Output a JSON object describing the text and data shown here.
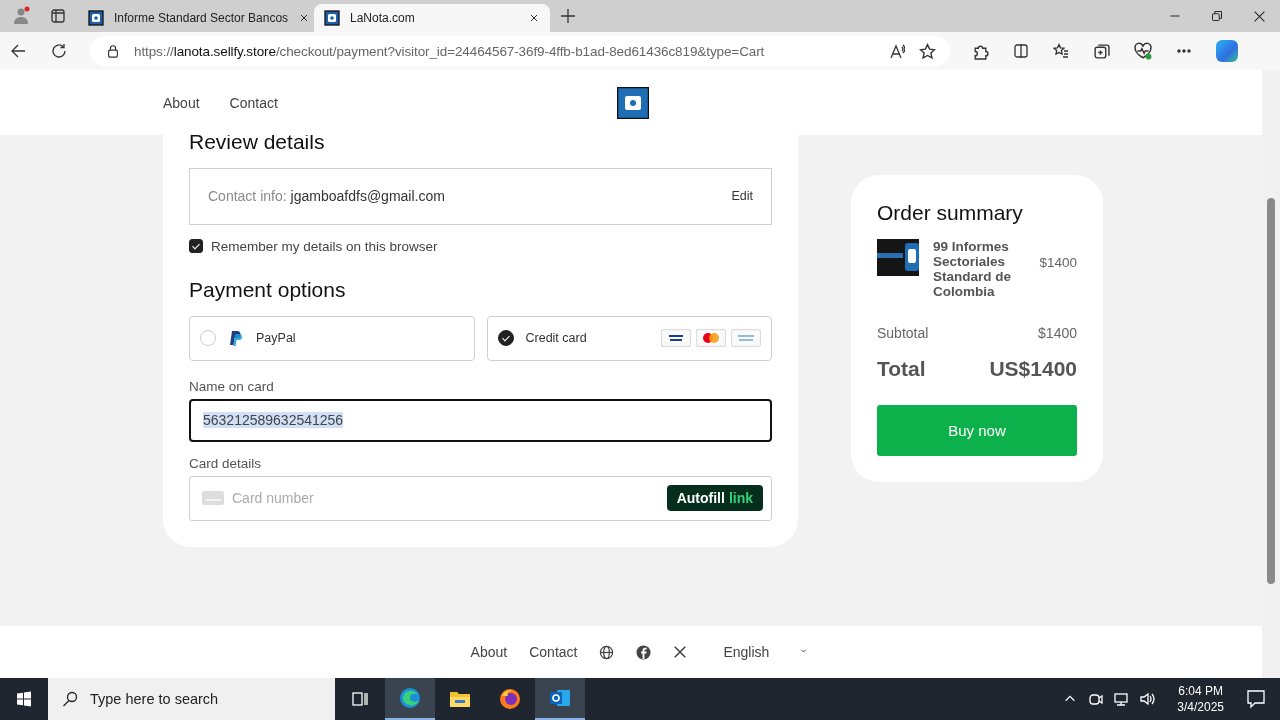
{
  "browser": {
    "tabs": [
      {
        "title": "Informe Standard Sector Bancos",
        "selected": false
      },
      {
        "title": "LaNota.com",
        "selected": true
      }
    ],
    "url": {
      "scheme": "https://",
      "host": "lanota.sellfy.store",
      "path": "/checkout/payment?visitor_id=24464567-36f9-4ffb-b1ad-8ed61436c819&type=Cart"
    }
  },
  "header": {
    "nav": [
      "About",
      "Contact"
    ]
  },
  "review": {
    "title": "Review details",
    "contact_label": "Contact info:",
    "contact_value": "jgamboafdfs@gmail.com",
    "edit": "Edit",
    "remember": {
      "label": "Remember my details on this browser",
      "checked": true
    }
  },
  "payment": {
    "title": "Payment options",
    "options": [
      {
        "kind": "paypal",
        "label": "PayPal",
        "selected": false
      },
      {
        "kind": "card",
        "label": "Credit card",
        "selected": true
      }
    ],
    "name_label": "Name on card",
    "name_value": "563212589632541256",
    "card_label": "Card details",
    "card_placeholder": "Card number",
    "autofill": {
      "text": "Autofill",
      "brand": "link"
    }
  },
  "summary": {
    "title": "Order summary",
    "items": [
      {
        "name": "99 Informes Sectoriales Standard de Colombia",
        "price": "$1400"
      }
    ],
    "subtotal_label": "Subtotal",
    "subtotal": "$1400",
    "total_label": "Total",
    "total": "US$1400",
    "buy": "Buy now"
  },
  "footer": {
    "links": [
      "About",
      "Contact"
    ],
    "language": "English"
  },
  "taskbar": {
    "search_placeholder": "Type here to search",
    "time": "6:04 PM",
    "date": "3/4/2025"
  }
}
